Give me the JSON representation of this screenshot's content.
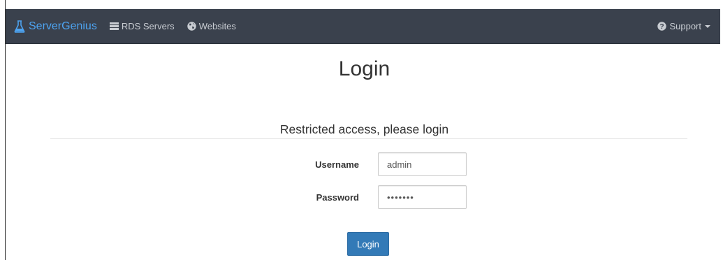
{
  "navbar": {
    "brand": "ServerGenius",
    "links": [
      {
        "label": "RDS Servers",
        "icon": "server-icon"
      },
      {
        "label": "Websites",
        "icon": "globe-icon"
      }
    ],
    "support": {
      "label": "Support",
      "icon": "question-circle-icon"
    },
    "colors": {
      "background": "#3a414d",
      "brand": "#4da3f0",
      "link": "#c8ccd2"
    }
  },
  "page": {
    "title": "Login",
    "subtitle": "Restricted access, please login"
  },
  "form": {
    "username_label": "Username",
    "username_value": "admin",
    "password_label": "Password",
    "password_value": "•••••••",
    "submit_label": "Login",
    "submit_color": "#337ab7"
  }
}
